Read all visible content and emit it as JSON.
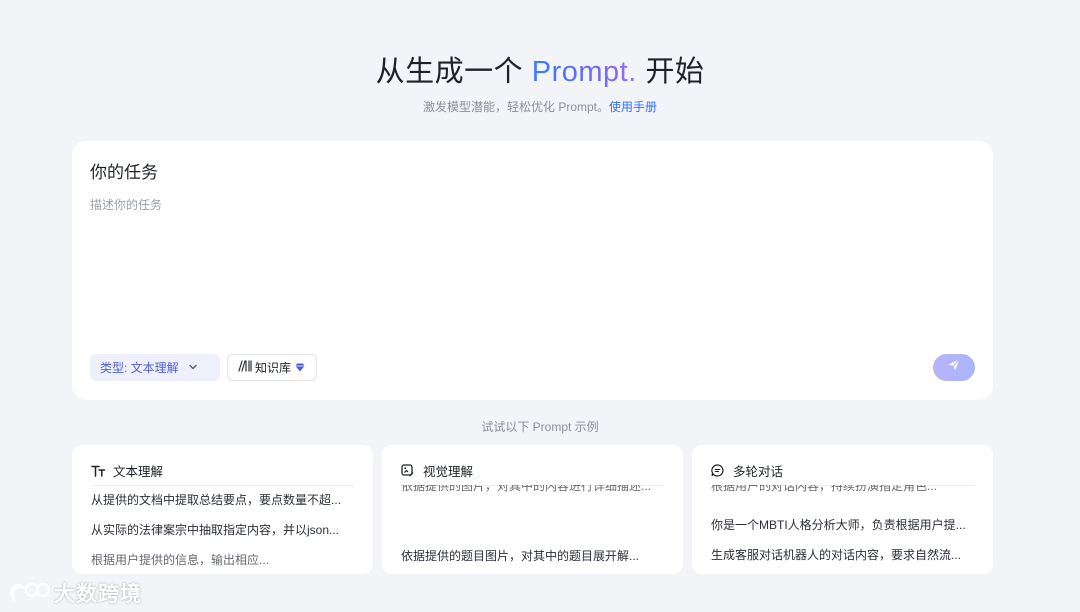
{
  "hero": {
    "title_prefix": "从生成一个 ",
    "title_brand": "Prompt.",
    "title_suffix": " 开始",
    "subtitle": "激发模型潜能，轻松优化 Prompt。",
    "manual_link": "使用手册"
  },
  "task": {
    "title": "你的任务",
    "placeholder": "描述你的任务",
    "type_label": "类型:  文本理解",
    "knowledge_label": "知识库",
    "send_icon": "send-icon"
  },
  "examples": {
    "hint": "试试以下 Prompt 示例",
    "cards": [
      {
        "title": "文本理解",
        "icon": "text-format-icon",
        "items": [
          "从提供的文档中提取总结要点，要点数量不超...",
          "从实际的法律案宗中抽取指定内容，并以json...",
          "根据用户提供的信息，输出相应..."
        ]
      },
      {
        "title": "视觉理解",
        "icon": "image-edit-icon",
        "items": [
          "依据提供的图片，对其中的内容进行详细描述...",
          "依据提供的题目图片，对其中的题目展开解..."
        ]
      },
      {
        "title": "多轮对话",
        "icon": "chat-icon",
        "items": [
          "根据用户的对话内容，持续扮演指定角色...",
          "你是一个MBTI人格分析大师，负责根据用户提...",
          "生成客服对话机器人的对话内容，要求自然流..."
        ]
      }
    ]
  },
  "watermark": "大数跨境",
  "colors": {
    "accent": "#3370ff",
    "brand_gradient_start": "#3d7cf5",
    "brand_gradient_end": "#9b6ef0",
    "type_pill_bg": "#eef0fd",
    "send_button": "#b3b4fb"
  }
}
